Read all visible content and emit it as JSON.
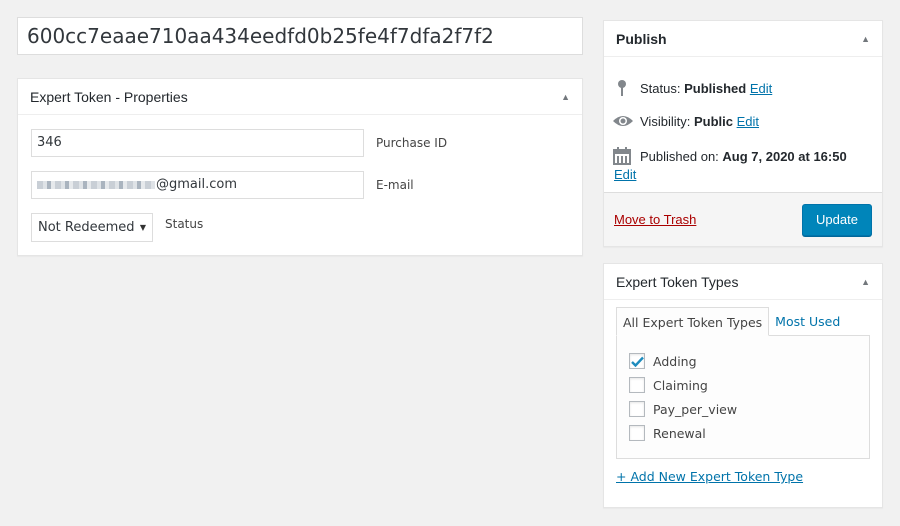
{
  "title_field": {
    "value": "600cc7eaae710aa434eedfd0b25fe4f7dfa2f7f2"
  },
  "properties_box": {
    "title": "Expert Token - Properties",
    "toggle_icon": "triangle-up",
    "fields": {
      "purchase_id": {
        "value": "346",
        "label": "Purchase ID"
      },
      "email": {
        "value_visible": "@gmail.com",
        "redacted_prefix": true,
        "label": "E-mail"
      },
      "status": {
        "selected": "Not Redeemed",
        "label": "Status"
      }
    }
  },
  "publish_box": {
    "title": "Publish",
    "toggle_icon": "triangle-up",
    "status": {
      "label": "Status:",
      "value": "Published",
      "edit": "Edit",
      "icon": "pin-icon"
    },
    "visibility": {
      "label": "Visibility:",
      "value": "Public",
      "edit": "Edit",
      "icon": "eye-icon"
    },
    "published_on": {
      "label": "Published on:",
      "value": "Aug 7, 2020 at 16:50",
      "edit": "Edit",
      "icon": "calendar-icon"
    },
    "trash_label": "Move to Trash",
    "update_label": "Update",
    "colors": {
      "primary": "#0085ba",
      "trash": "#a00000",
      "link": "#0073aa"
    }
  },
  "types_box": {
    "title": "Expert Token Types",
    "toggle_icon": "triangle-up",
    "tabs": [
      {
        "label": "All Expert Token Types",
        "active": true
      },
      {
        "label": "Most Used",
        "active": false
      }
    ],
    "items": [
      {
        "label": "Adding",
        "checked": true
      },
      {
        "label": "Claiming",
        "checked": false
      },
      {
        "label": "Pay_per_view",
        "checked": false
      },
      {
        "label": "Renewal",
        "checked": false
      }
    ],
    "add_new_label": "+ Add New Expert Token Type"
  }
}
